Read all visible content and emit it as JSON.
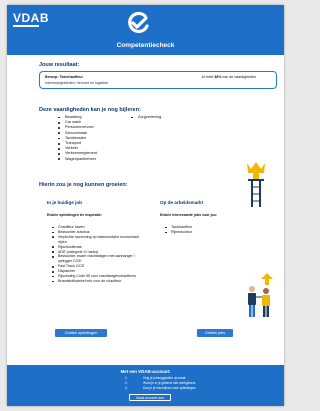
{
  "header": {
    "logo": "VDAB",
    "title": "Competentiecheck"
  },
  "result": {
    "heading": "Jouw resultaat:",
    "beroep_label": "Beroep:",
    "beroep_value": "Taxichauffeur",
    "interest_label": "Interessegebieden:",
    "interest_value": "Vervoer en logistiek",
    "match_prefix": "Je hebt",
    "match_percent": "38%",
    "match_suffix": "van de vaardigheden"
  },
  "skills": {
    "heading": "Deze vaardigheden kan je nog bijleren:",
    "col1": [
      "Bewaking",
      "Car wash",
      "Personenvervoer",
      "Schoonmaak",
      "Taxidiensten",
      "Transport",
      "Verkeer",
      "Verkeersreglement",
      "Wagenparkbeheer"
    ],
    "col2": [
      "Zorgverlening"
    ]
  },
  "growth": {
    "heading": "Hierin zou je nog kunnen groeien:",
    "job": {
      "title": "In je huidige job",
      "subtitle": "Enkele opleidingen ter inspiratie:",
      "items": [
        "Chauffeur haven",
        "Bestuurder autobus",
        "Verplichte navorming op basismodator economisch rijden",
        "Rijschoolleraar",
        "ADR (categorie II / tanks)",
        "Bestuurder zware vrachtwagen met aanhanger / oplegger C/CE",
        "Fast Track C/CE",
        "Dispatcher",
        "Rijscholing Code 95 voor vrachtwagenchauffeurs",
        "Brandstoffosiekel info voor de chauffeur"
      ],
      "button": "Ontdek opleidingen"
    },
    "market": {
      "title": "Op de arbeidsmarkt",
      "subtitle": "Enkele interessante jobs voor jou:",
      "items": [
        "Taxichauffeur",
        "Rijinstructeur"
      ],
      "button": "Ontdek jobs"
    }
  },
  "footer": {
    "title": "Met een VDAB-account:",
    "items": [
      {
        "num": "1.",
        "text": "Volg je jobsuggesties op maat"
      },
      {
        "num": "2.",
        "text": "Word je in je gekend met werkgevers"
      },
      {
        "num": "3.",
        "text": "Kan je je inschrijven voor opleidingen"
      }
    ],
    "button": "Maak account aan"
  },
  "colors": {
    "brand_blue": "#1e6fc7",
    "heading_navy": "#0f3a70",
    "accent_yellow": "#f2b705"
  }
}
